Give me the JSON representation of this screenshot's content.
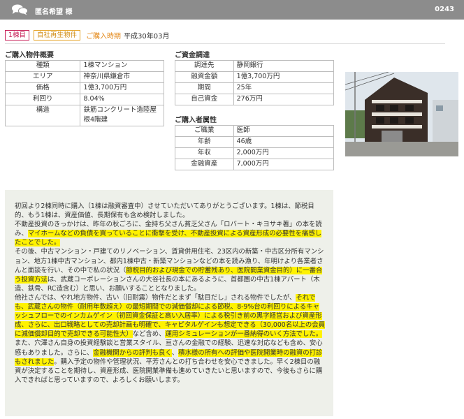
{
  "header": {
    "name": "匿名希望 様",
    "number": "0243"
  },
  "tags": {
    "building_count": "1棟目",
    "property_type": "自社再生物件",
    "purchase_label": "ご購入時期",
    "purchase_value": "平成30年03月"
  },
  "property": {
    "title": "ご購入物件概要",
    "rows": [
      {
        "k": "種類",
        "v": "1棟マンション"
      },
      {
        "k": "エリア",
        "v": "神奈川県鎌倉市"
      },
      {
        "k": "価格",
        "v": "1億3,700万円"
      },
      {
        "k": "利回り",
        "v": "8.04%"
      },
      {
        "k": "構造",
        "v": "鉄筋コンクリート造陸屋根4階建"
      }
    ]
  },
  "funding": {
    "title": "ご資金調達",
    "rows": [
      {
        "k": "調達先",
        "v": "静岡銀行"
      },
      {
        "k": "融資金額",
        "v": "1億3,700万円"
      },
      {
        "k": "期間",
        "v": "25年"
      },
      {
        "k": "自己資金",
        "v": "276万円"
      }
    ]
  },
  "buyer": {
    "title": "ご購入者属性",
    "rows": [
      {
        "k": "ご職業",
        "v": "医師"
      },
      {
        "k": "年齢",
        "v": "46歳"
      },
      {
        "k": "年収",
        "v": "2,000万円"
      },
      {
        "k": "金融資産",
        "v": "7,000万円"
      }
    ]
  },
  "story": {
    "p1": "初回より2棟同時に購入（1棟は融資審査中）させていただいてありがとうございます。1棟は、節税目的、もう1棟は、資産価値、長期保有も含め検討しました。",
    "p2a": "不動産投資のきっかけは、昨年の秋ごろに、金持ち父さん貧乏父さん「ロバート・キヨサキ著」の本を読み、",
    "p2h": "マイホームなどの負債を買っていることに衝撃を受け、不動産投資による資産形成の必要性を痛感したことでした。",
    "p3a": "その後、中古マンション・戸建てのリノベーション、賃貸併用住宅、23区内の新築・中古区分所有マンション、地方1棟中古マンション、都内1棟中古・新築マンションなどの本を読み漁り、年明けより各業者さんと面談を行い、その中で私の状況（",
    "p3h": "節税目的および現金での貯蓄残あり、医院開業資金目的）に一番合う投資方法",
    "p3b": "は、武蔵コーポレーションさんの大谷社長の本にあるように、首都圏の中古1棟アパート（木造、鉄骨、RC造含む）と思い、お願いすることとなりました。",
    "p4a": "他社さんでは、やれ地方物件、古い（旧耐震）物件だとまず「駄目だし」される物件でしたが、",
    "p4h": "それでも、武蔵さんの物件（耐用年数超え）の最短期間での減価償却による節税、8-9%台の利回りによるキャッシュフローでのインカムゲイン（初回資金保証と高い入居率）による税引き前の黒字経営および資産形成、さらに、出口戦略としての売却計画も明確で、キャピタルゲインも想定できる（30,000名以上の会員に減価償却目的で売却できる可能性大）",
    "p4b": "など含め、",
    "p4h2": "運用シミュレーションが一番納得のいく方法でした。",
    "p5a": "また、穴澤さん自身の投資経験談と営業スタイル、亘さんの金融での経験、迅速な対応なども含め、安心感もありました。さらに、",
    "p5h1": "金融機関からの評判も良く",
    "p5b": "、",
    "p5h2": "積水様の所有への評価や医院開業時の融資の打診もされました",
    "p5c": "。購入予定の物件や管理状況、平芳さんとの打ち合わせを安心できました。早く2棟目の融資が決定することを期待し、資産形成、医院開業準備も進めていきたいと思いますので、今後もさらに購入できればと思っていますので、よろしくお願いします。"
  }
}
